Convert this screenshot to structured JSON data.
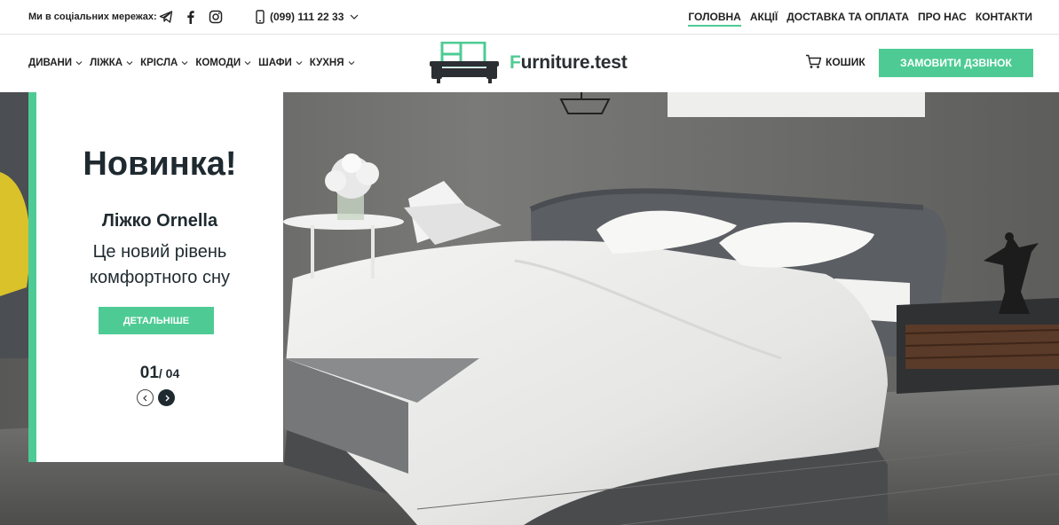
{
  "topbar": {
    "social_label": "Ми в соціальних мережах:",
    "social_icons": [
      "telegram-icon",
      "facebook-icon",
      "instagram-icon"
    ],
    "phone": "(099) 111 22 33",
    "nav": [
      {
        "label": "ГОЛОВНА",
        "active": true
      },
      {
        "label": "АКЦІЇ",
        "active": false
      },
      {
        "label": "ДОСТАВКА ТА ОПЛАТА",
        "active": false
      },
      {
        "label": "ПРО НАС",
        "active": false
      },
      {
        "label": "КОНТАКТИ",
        "active": false
      }
    ]
  },
  "header": {
    "categories": [
      "ДИВАНИ",
      "ЛІЖКА",
      "КРІСЛА",
      "КОМОДИ",
      "ШАФИ",
      "КУХНЯ"
    ],
    "logo_first_letter": "F",
    "logo_rest": "urniture.test",
    "cart_label": "КОШИК",
    "callback_label": "ЗАМОВИТИ ДЗВІНОК"
  },
  "hero": {
    "title": "Новинка!",
    "subtitle": "Ліжко Ornella",
    "description": "Це новий рівень комфортного сну",
    "button_label": "ДЕТАЛЬНІШЕ",
    "current": "01",
    "total": "/ 04"
  },
  "colors": {
    "accent": "#4ecb94",
    "dark": "#1f2a30"
  }
}
